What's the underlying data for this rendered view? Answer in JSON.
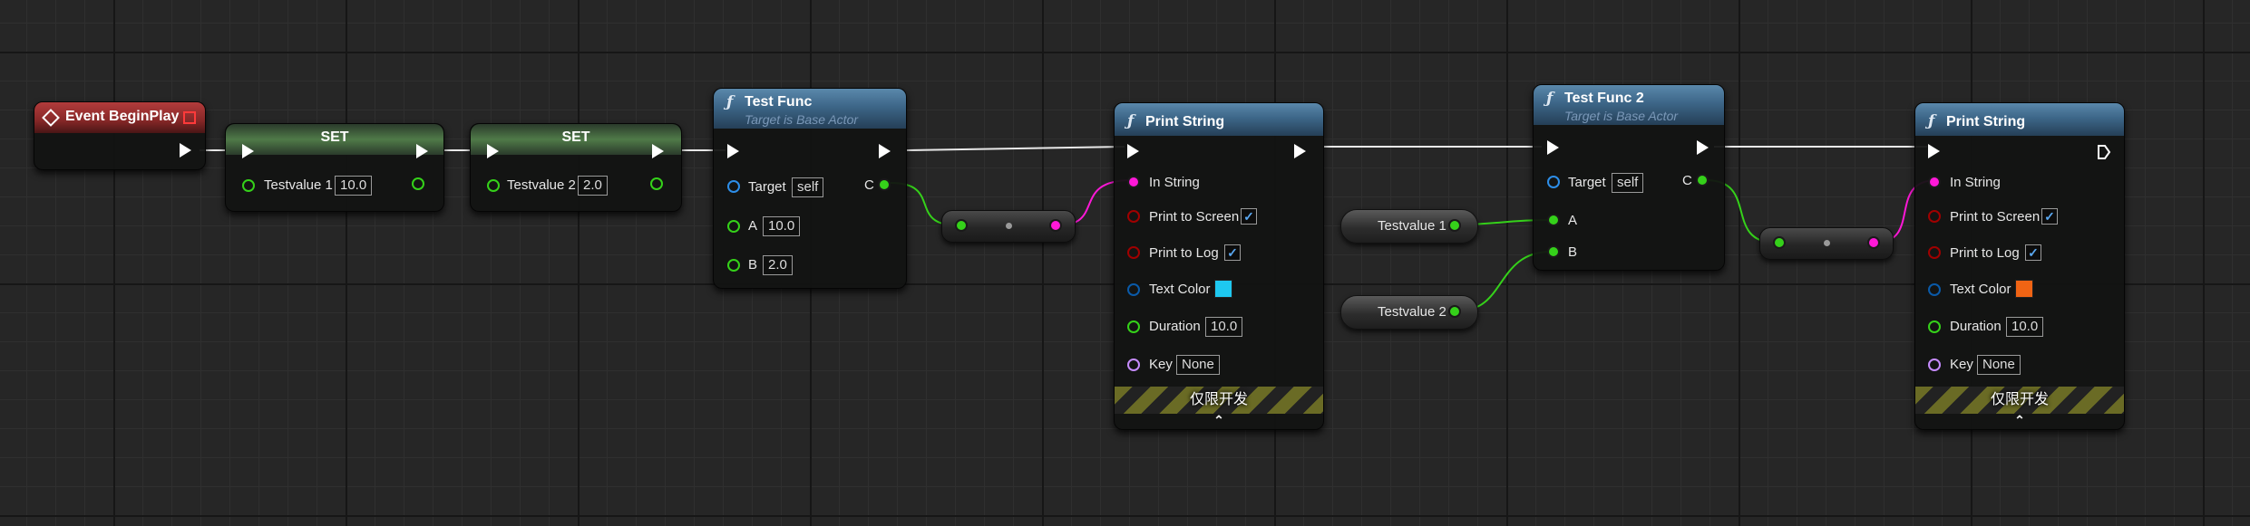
{
  "event_node": {
    "title": "Event BeginPlay"
  },
  "set_nodes": [
    {
      "title": "SET",
      "var_label": "Testvalue 1",
      "value": "10.0"
    },
    {
      "title": "SET",
      "var_label": "Testvalue 2",
      "value": "2.0"
    }
  ],
  "test_func": {
    "title": "Test Func",
    "subtitle": "Target is Base Actor",
    "target_label": "Target",
    "target_value": "self",
    "a_label": "A",
    "a_value": "10.0",
    "b_label": "B",
    "b_value": "2.0",
    "c_label": "C"
  },
  "print_string_1": {
    "title": "Print String",
    "in_string_label": "In String",
    "print_screen_label": "Print to Screen",
    "print_log_label": "Print to Log",
    "text_color_label": "Text Color",
    "text_color": "#1ec8f0",
    "duration_label": "Duration",
    "duration_value": "10.0",
    "key_label": "Key",
    "key_value": "None",
    "dev_only": "仅限开发",
    "check_mark": "✓",
    "chevron": "⌃"
  },
  "var_getters": [
    {
      "label": "Testvalue 1"
    },
    {
      "label": "Testvalue 2"
    }
  ],
  "test_func_2": {
    "title": "Test Func 2",
    "subtitle": "Target is Base Actor",
    "target_label": "Target",
    "target_value": "self",
    "a_label": "A",
    "b_label": "B",
    "c_label": "C"
  },
  "print_string_2": {
    "title": "Print String",
    "in_string_label": "In String",
    "print_screen_label": "Print to Screen",
    "print_log_label": "Print to Log",
    "text_color_label": "Text Color",
    "text_color": "#f06414",
    "duration_label": "Duration",
    "duration_value": "10.0",
    "key_label": "Key",
    "key_value": "None",
    "dev_only": "仅限开发",
    "check_mark": "✓",
    "chevron": "⌃"
  },
  "colors": {
    "exec": "#ffffff",
    "float_pin": "#35d11a",
    "string_pin": "#ff18d8",
    "bool_pin": "#a00000",
    "object_pin": "#2d8ee8",
    "struct_pin": "#0a5aa8",
    "name_pin": "#c68cff"
  }
}
